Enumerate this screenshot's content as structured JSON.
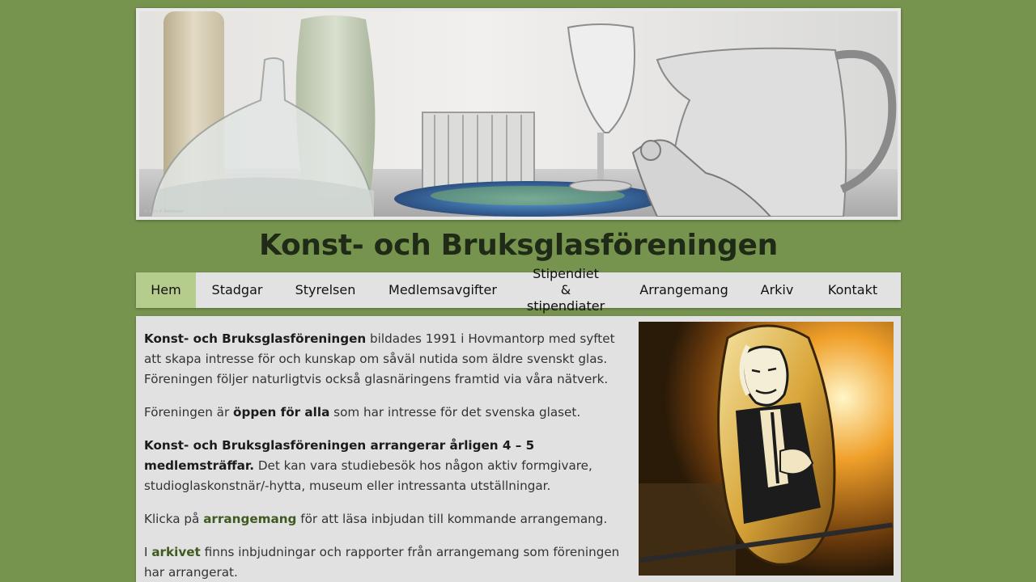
{
  "banner": {
    "credit": "© Lars V. Åkerblom"
  },
  "site": {
    "title": "Konst- och Bruksglasföreningen"
  },
  "nav": {
    "items": [
      {
        "label": "Hem",
        "active": true
      },
      {
        "label": "Stadgar",
        "active": false
      },
      {
        "label": "Styrelsen",
        "active": false
      },
      {
        "label": "Medlemsavgifter",
        "active": false
      },
      {
        "label": "Stipendiet & stipendiater",
        "active": false
      },
      {
        "label": "Arrangemang",
        "active": false
      },
      {
        "label": "Arkiv",
        "active": false
      },
      {
        "label": "Kontakt",
        "active": false
      }
    ]
  },
  "content": {
    "p1": {
      "bold": "Konst- och Bruksglasföreningen",
      "text": " bildades 1991 i Hovmantorp med syftet att skapa intresse för och kunskap om såväl nutida som äldre svenskt glas. Föreningen följer naturligtvis också glasnäringens framtid via våra nätverk."
    },
    "p2": {
      "pre": "Föreningen är ",
      "bold": "öppen för alla",
      "post": " som har intresse för det svenska glaset."
    },
    "p3": {
      "bold": "Konst- och Bruksglasföreningen arrangerar årligen 4 – 5 medlemsträffar.",
      "text": " Det kan vara studiebesök hos någon aktiv formgivare, studioglaskonstnär/-hytta, museum eller intressanta utställningar."
    },
    "p4": {
      "pre": "Klicka på ",
      "link": "arrangemang",
      "post": " för att läsa inbjudan till kommande arrangemang."
    },
    "p5": {
      "pre": "I ",
      "link": "arkivet",
      "post": " finns inbjudningar och rapporter från arrangemang som föreningen har arrangerat."
    }
  },
  "colors": {
    "background": "#77944f",
    "nav_active": "#b5cc8c",
    "link": "#3f5a1f"
  }
}
